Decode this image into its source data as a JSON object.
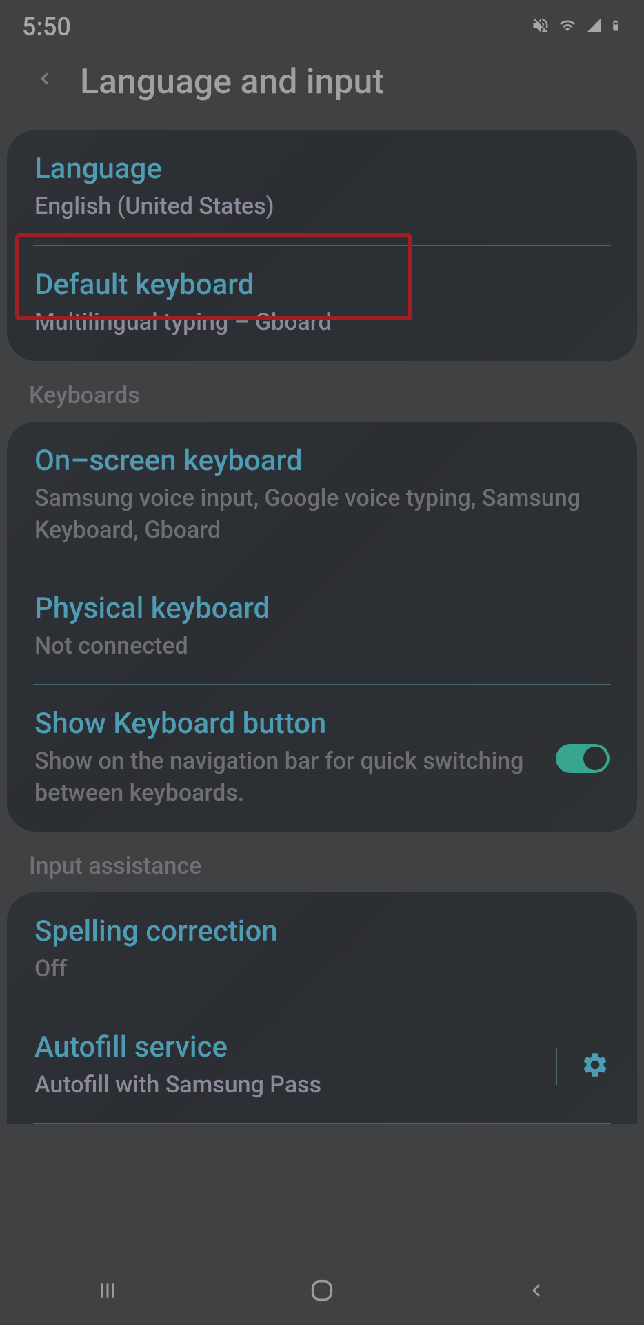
{
  "status": {
    "time": "5:50"
  },
  "header": {
    "title": "Language and input"
  },
  "section1": {
    "language": {
      "title": "Language",
      "subtitle": "English (United States)"
    },
    "default_keyboard": {
      "title": "Default keyboard",
      "subtitle": "Multilingual typing – Gboard"
    }
  },
  "keyboards_header": "Keyboards",
  "section2": {
    "onscreen": {
      "title": "On–screen keyboard",
      "subtitle": "Samsung voice input, Google voice typing, Samsung Keyboard, Gboard"
    },
    "physical": {
      "title": "Physical keyboard",
      "subtitle": "Not connected"
    },
    "show_button": {
      "title": "Show Keyboard button",
      "subtitle": "Show on the navigation bar for quick switching between keyboards.",
      "toggle": true
    }
  },
  "input_assistance_header": "Input assistance",
  "section3": {
    "spelling": {
      "title": "Spelling correction",
      "subtitle": "Off"
    },
    "autofill": {
      "title": "Autofill service",
      "subtitle": "Autofill with Samsung Pass"
    }
  }
}
